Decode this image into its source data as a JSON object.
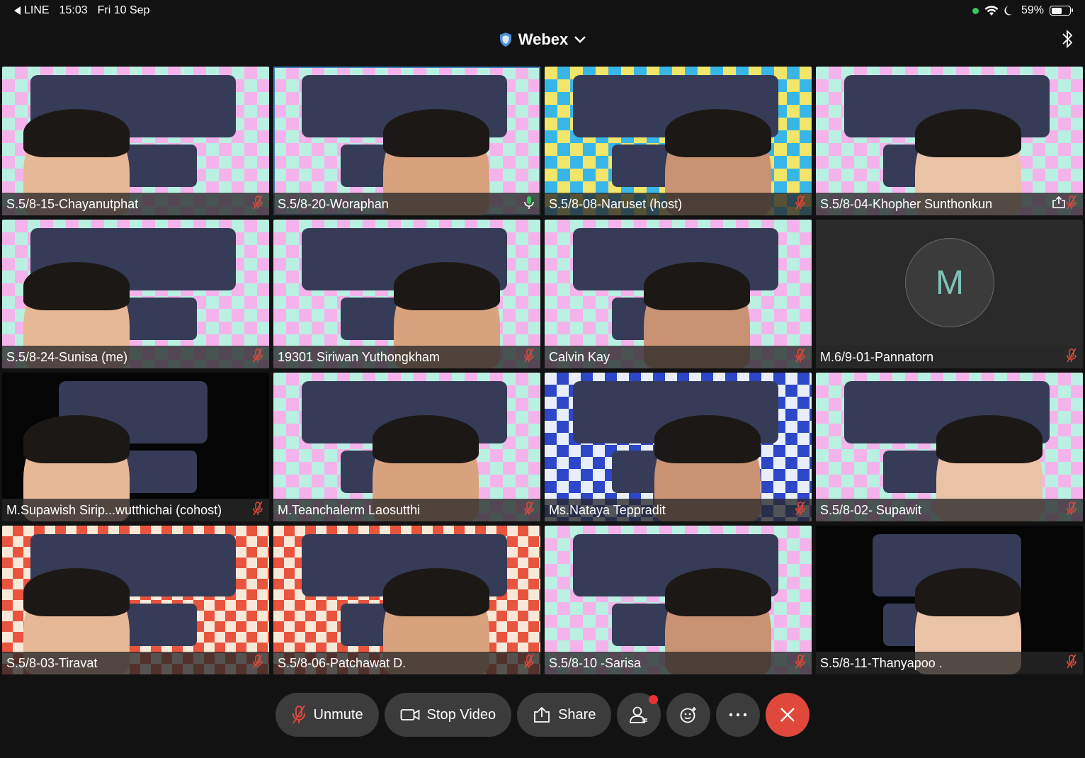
{
  "status_bar": {
    "back_app": "LINE",
    "time": "15:03",
    "date": "Fri 10 Sep",
    "battery": "59%",
    "battery_level": 0.59
  },
  "title": "Webex",
  "participants": [
    {
      "name": "S.5/8-15-Chayanutphat",
      "muted": true,
      "bg": "pastel"
    },
    {
      "name": "S.5/8-20-Woraphan",
      "muted": false,
      "bg": "pastel",
      "active_speaker": true
    },
    {
      "name": "S.5/8-08-Naruset (host)",
      "muted": true,
      "bg": "cyan"
    },
    {
      "name": "S.5/8-04-Khopher Sunthonkun",
      "muted": true,
      "bg": "pastel",
      "sharing": true
    },
    {
      "name": "S.5/8-24-Sunisa (me)",
      "muted": true,
      "bg": "pastel"
    },
    {
      "name": "19301 Siriwan Yuthongkham",
      "muted": true,
      "bg": "pastel"
    },
    {
      "name": "Calvin Kay",
      "muted": true,
      "bg": "pastel"
    },
    {
      "name": "M.6/9-01-Pannatorn",
      "muted": true,
      "bg": "dark",
      "avatar_initial": "M"
    },
    {
      "name": "M.Supawish Sirip...wutthichai (cohost)",
      "muted": true,
      "bg": "black"
    },
    {
      "name": "M.Teanchalerm Laosutthi",
      "muted": true,
      "bg": "pastel"
    },
    {
      "name": "Ms.Nataya Teppradit",
      "muted": true,
      "bg": "blue"
    },
    {
      "name": "S.5/8-02- Supawit",
      "muted": true,
      "bg": "pastel"
    },
    {
      "name": "S.5/8-03-Tiravat",
      "muted": true,
      "bg": "red"
    },
    {
      "name": "S.5/8-06-Patchawat D.",
      "muted": true,
      "bg": "red"
    },
    {
      "name": "S.5/8-10 -Sarisa",
      "muted": true,
      "bg": "pastel"
    },
    {
      "name": "S.5/8-11-Thanyapoo .",
      "muted": true,
      "bg": "black"
    }
  ],
  "controls": {
    "unmute_label": "Unmute",
    "stop_video_label": "Stop Video",
    "share_label": "Share"
  },
  "colors": {
    "muted_icon": "#e0483b",
    "unmuted_icon": "#34c759",
    "end_button": "#e0483b",
    "active_outline": "#3f7fb8"
  }
}
